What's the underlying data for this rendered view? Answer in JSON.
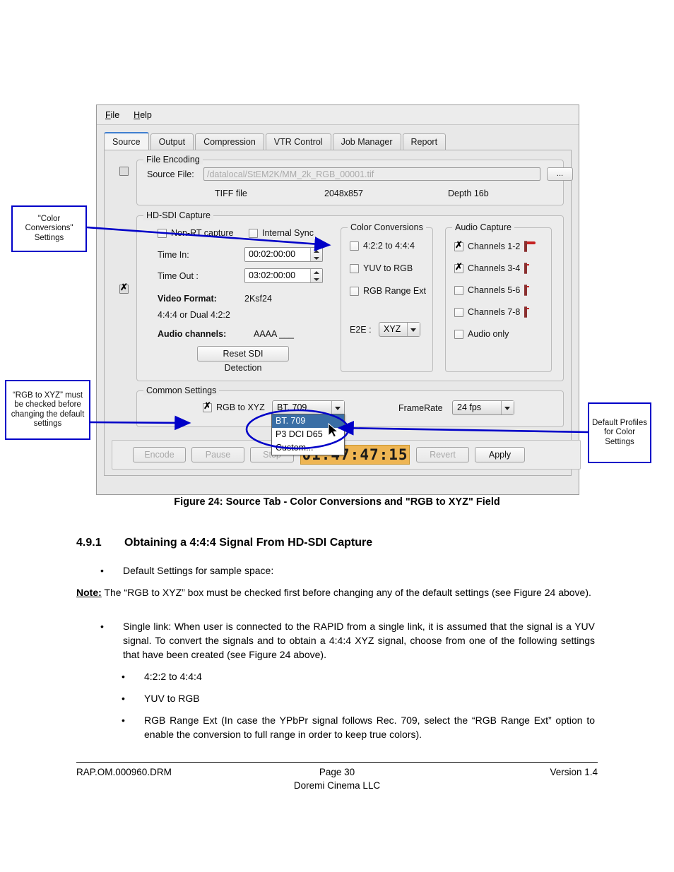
{
  "app": {
    "menu": [
      "File",
      "Help"
    ],
    "tabs": [
      {
        "label": "Source",
        "active": true
      },
      {
        "label": "Output",
        "active": false
      },
      {
        "label": "Compression",
        "active": false
      },
      {
        "label": "VTR Control",
        "active": false
      },
      {
        "label": "Job Manager",
        "active": false
      },
      {
        "label": "Report",
        "active": false
      }
    ],
    "file_encoding": {
      "title": "File Encoding",
      "source_file_label": "Source File:",
      "source_file_value": "/datalocal/StEM2K/MM_2k_RGB_00001.tif",
      "browse_label": "...",
      "file_type": "TIFF file",
      "resolution": "2048x857",
      "depth": "Depth 16b"
    },
    "hdsdi": {
      "title": "HD-SDI Capture",
      "non_rt_label": "Non-RT capture",
      "internal_sync_label": "Internal Sync",
      "time_in_label": "Time In:",
      "time_in_value": "00:02:00:00",
      "time_out_label": "Time Out :",
      "time_out_value": "03:02:00:00",
      "video_format_label": "Video Format:",
      "video_format_value": "2Ksf24",
      "video_format_sub": "4:4:4 or Dual 4:2:2",
      "audio_channels_label": "Audio channels:",
      "audio_channels_value": "AAAA ___",
      "reset_button": "Reset SDI Detection"
    },
    "color_conversions": {
      "title": "Color Conversions",
      "options": [
        {
          "label": "4:2:2 to 4:4:4",
          "checked": false
        },
        {
          "label": "YUV to RGB",
          "checked": false
        },
        {
          "label": "RGB Range Ext",
          "checked": false
        }
      ],
      "e2e_label": "E2E :",
      "e2e_value": "XYZ"
    },
    "audio_capture": {
      "title": "Audio Capture",
      "channels": [
        {
          "label": "Channels 1-2",
          "checked": true,
          "level": 55
        },
        {
          "label": "Channels 3-4",
          "checked": true,
          "level": 0
        },
        {
          "label": "Channels 5-6",
          "checked": false,
          "level": 0
        },
        {
          "label": "Channels 7-8",
          "checked": false,
          "level": 0
        }
      ],
      "audio_only_label": "Audio only",
      "audio_only_checked": false
    },
    "common_settings": {
      "title": "Common Settings",
      "rgb_to_xyz_label": "RGB to XYZ",
      "rgb_to_xyz_checked": true,
      "profile_value": "BT. 709",
      "profile_options": [
        {
          "label": "BT. 709",
          "selected": true
        },
        {
          "label": "P3 DCI D65",
          "selected": false
        },
        {
          "label": "Custom...",
          "selected": false
        }
      ],
      "framerate_label": "FrameRate",
      "framerate_value": "24 fps"
    },
    "transport": {
      "encode": "Encode",
      "pause": "Pause",
      "stop": "Stop",
      "timecode": "01:47:47:15",
      "revert": "Revert",
      "apply": "Apply"
    }
  },
  "annotations": {
    "color_conversions_note": "\"Color Conversions\" Settings",
    "rgb_xyz_note": "“RGB to XYZ” must be checked before changing the default settings",
    "default_profiles_note": "Default Profiles for Color Settings",
    "accent_color": "#0000c8"
  },
  "document": {
    "figure_caption": "Figure 24: Source Tab - Color Conversions and \"RGB to XYZ\" Field",
    "section_number": "4.9.1",
    "section_title": "Obtaining a 4:4:4 Signal From HD-SDI Capture",
    "bullet_default": "Default Settings for sample space:",
    "note_label": "Note:",
    "note_text": " The “RGB to XYZ” box must be checked first before changing any of the default settings (see Figure 24 above).",
    "bullet_single_link": "Single link: When user is connected to the RAPID from a single link, it is assumed that the signal is a YUV signal. To convert the signals and to obtain a 4:4:4 XYZ signal, choose from one of the  following settings that have been created (see Figure 24 above).",
    "sub_bullets": [
      "4:2:2 to 4:4:4",
      "YUV to RGB",
      "RGB Range Ext (In case the YPbPr signal follows Rec. 709, select the “RGB Range Ext” option to enable the conversion to full range in order to keep true colors)."
    ],
    "footer_left": "RAP.OM.000960.DRM",
    "footer_center_page": "Page 30",
    "footer_center_company": "Doremi Cinema LLC",
    "footer_right": "Version 1.4"
  }
}
